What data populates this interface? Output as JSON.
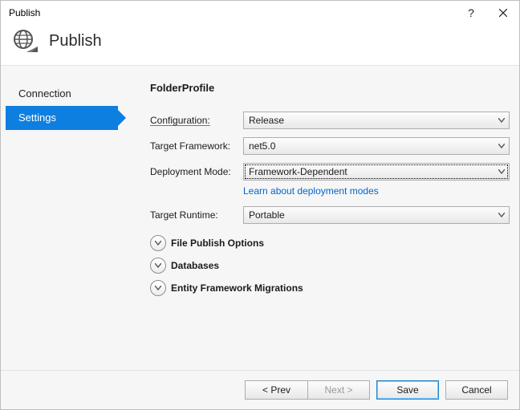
{
  "window": {
    "title": "Publish"
  },
  "header": {
    "title": "Publish"
  },
  "nav": {
    "items": [
      {
        "label": "Connection",
        "selected": false
      },
      {
        "label": "Settings",
        "selected": true
      }
    ]
  },
  "content": {
    "profile_title": "FolderProfile",
    "labels": {
      "configuration": "Configuration:",
      "target_framework": "Target Framework:",
      "deployment_mode": "Deployment Mode:",
      "target_runtime": "Target Runtime:"
    },
    "values": {
      "configuration": "Release",
      "target_framework": "net5.0",
      "deployment_mode": "Framework-Dependent",
      "target_runtime": "Portable"
    },
    "learn_link": "Learn about deployment modes",
    "expanders": [
      "File Publish Options",
      "Databases",
      "Entity Framework Migrations"
    ]
  },
  "footer": {
    "prev": "< Prev",
    "next": "Next >",
    "save": "Save",
    "cancel": "Cancel"
  }
}
